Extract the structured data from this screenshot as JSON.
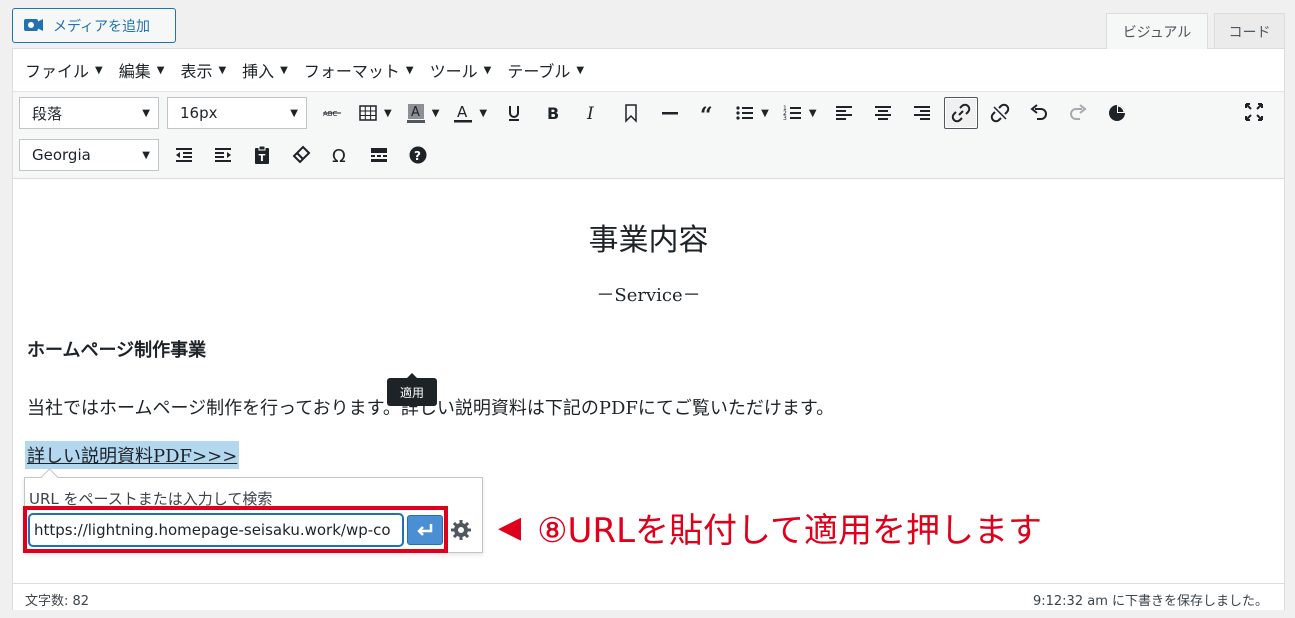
{
  "toolbar_top": {
    "add_media_label": "メディアを追加",
    "tab_visual": "ビジュアル",
    "tab_code": "コード"
  },
  "menubar": {
    "items": [
      {
        "label": "ファイル"
      },
      {
        "label": "編集"
      },
      {
        "label": "表示"
      },
      {
        "label": "挿入"
      },
      {
        "label": "フォーマット"
      },
      {
        "label": "ツール"
      },
      {
        "label": "テーブル"
      }
    ]
  },
  "toolbar": {
    "format_select": "段落",
    "font_size_select": "16px",
    "font_family_select": "Georgia",
    "row1_icons": [
      "strikethrough-icon",
      "table-icon",
      "background-color-icon",
      "text-color-icon",
      "underline-icon",
      "bold-icon",
      "italic-icon",
      "bookmark-icon",
      "horizontal-rule-icon",
      "blockquote-icon",
      "bullet-list-icon",
      "numbered-list-icon",
      "align-left-icon",
      "align-center-icon",
      "align-right-icon",
      "insert-link-icon",
      "unlink-icon",
      "undo-icon",
      "redo-icon",
      "pie-chart-icon",
      "fullscreen-icon"
    ],
    "row2_icons": [
      "outdent-icon",
      "indent-icon",
      "paste-as-text-icon",
      "clear-formatting-icon",
      "special-character-icon",
      "read-more-icon",
      "help-icon"
    ]
  },
  "content": {
    "title": "事業内容",
    "subtitle": "－Service－",
    "section_heading": "ホームページ制作事業",
    "paragraph": "当社ではホームページ制作を行っております。詳しい説明資料は下記のPDFにてご覧いただけます。",
    "selected_link_text": "詳しい説明資料PDF>>>"
  },
  "link_popup": {
    "hint": "URL をペーストまたは入力して検索",
    "url_value": "https://lightning.homepage-seisaku.work/wp-co",
    "apply_tooltip": "適用"
  },
  "annotation": {
    "arrow": "◀",
    "text": "⑧URLを貼付して適用を押します"
  },
  "statusbar": {
    "word_count": "文字数: 82",
    "autosave": "9:12:32 am に下書きを保存しました。"
  },
  "colors": {
    "accent": "#2271b1",
    "annotation_red": "#e0001b",
    "selection_blue": "#b4d7f0"
  }
}
